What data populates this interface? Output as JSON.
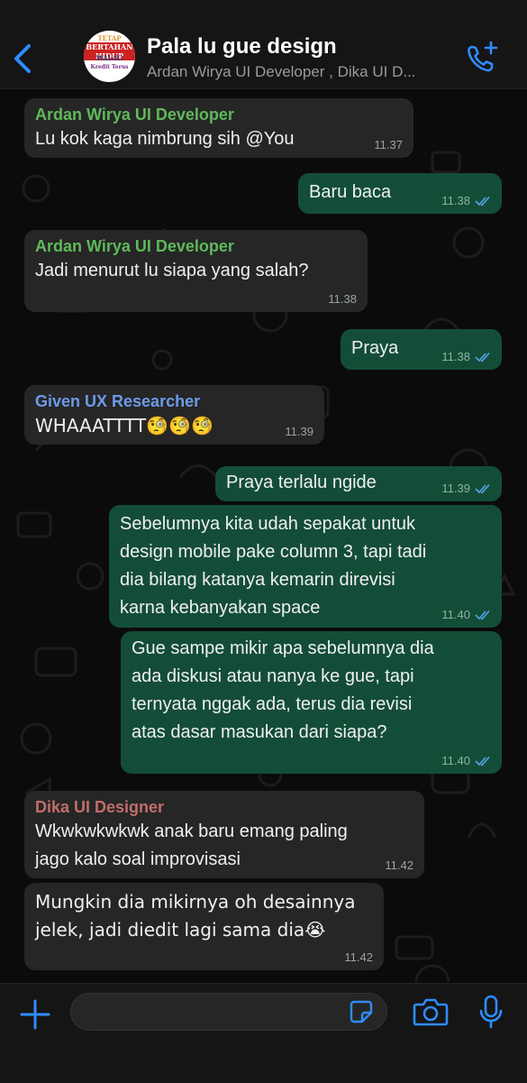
{
  "header": {
    "title": "Pala lu gue design",
    "subtitle": "Ardan Wirya UI Developer , Dika UI D...",
    "avatar_lines": [
      "TETAP",
      "BERTAHAN HIDUP",
      "WALAU",
      "Kredit Terus"
    ],
    "back_icon": "chevron-left-icon",
    "call_icon": "add-call-icon"
  },
  "messages": [
    {
      "dir": "in",
      "sender": "Ardan Wirya UI Developer",
      "sender_color": "#5fb95a",
      "text": "Lu kok kaga nimbrung sih @You",
      "time": "11.37"
    },
    {
      "dir": "out",
      "text": "Baru baca",
      "time": "11.38",
      "read": true
    },
    {
      "dir": "in",
      "sender": "Ardan Wirya UI Developer",
      "sender_color": "#5fb95a",
      "text": "Jadi menurut lu siapa yang salah?",
      "time": "11.38"
    },
    {
      "dir": "out",
      "text": "Praya",
      "time": "11.38",
      "read": true
    },
    {
      "dir": "in",
      "sender": "Given UX Researcher",
      "sender_color": "#6c9be8",
      "text": "WHAAATTTT🧐🧐🧐",
      "time": "11.39"
    },
    {
      "dir": "out",
      "text": "Praya terlalu ngide",
      "time": "11.39",
      "read": true
    },
    {
      "dir": "out",
      "text": "Sebelumnya kita udah sepakat untuk\ndesign mobile pake column 3, tapi tadi\ndia bilang katanya kemarin direvisi\nkarna kebanyakan space",
      "time": "11.40",
      "read": true
    },
    {
      "dir": "out",
      "text": "Gue sampe mikir apa sebelumnya dia\nada diskusi atau nanya ke gue, tapi\nternyata nggak ada, terus dia revisi\natas dasar masukan dari siapa?",
      "time": "11.40",
      "read": true
    },
    {
      "dir": "in",
      "sender": "Dika UI Designer",
      "sender_color": "#c06e6a",
      "text": "Wkwkwkwkwk anak baru emang paling\njago kalo soal improvisasi",
      "time": "11.42"
    },
    {
      "dir": "in",
      "text": "Mungkin dia mikirnya oh desainnya\njelek, jadi diedit lagi sama dia😭",
      "time": "11.42"
    }
  ],
  "composer": {
    "plus_icon": "plus-icon",
    "sticker_icon": "sticker-icon",
    "camera_icon": "camera-icon",
    "mic_icon": "microphone-icon"
  },
  "colors": {
    "accent": "#2f8cff",
    "outgoing": "#144d37",
    "incoming": "#262626"
  }
}
